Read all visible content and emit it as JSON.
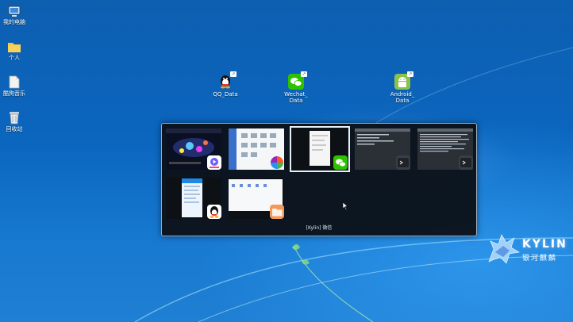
{
  "desktop_icons": [
    {
      "label": "我的电脑",
      "icon": "computer-icon"
    },
    {
      "label": "个人",
      "icon": "folder-icon"
    },
    {
      "label": "酷狗音乐",
      "icon": "file-icon"
    },
    {
      "label": "回收站",
      "icon": "trash-icon"
    }
  ],
  "app_icons": [
    {
      "label": "QQ_Data",
      "icon": "qq-icon",
      "color": "#ffffff"
    },
    {
      "label_lines": [
        "Wechat_",
        "Data"
      ],
      "icon": "wechat-icon",
      "color": "#2dc100"
    },
    {
      "label_lines": [
        "Android_",
        "Data"
      ],
      "icon": "android-icon",
      "color": "#8bc34a"
    }
  ],
  "switcher": {
    "title": "[Kylin] 微信",
    "windows": [
      {
        "name": "video-player-window",
        "badge": "video-app-icon"
      },
      {
        "name": "file-manager-window",
        "badge": "color-palette-icon"
      },
      {
        "name": "wechat-window",
        "badge": "wechat-icon",
        "selected": true
      },
      {
        "name": "terminal-window-1",
        "badge": "terminal-icon"
      },
      {
        "name": "terminal-window-2",
        "badge": "terminal-icon"
      },
      {
        "name": "qq-window",
        "badge": "qq-icon"
      },
      {
        "name": "folder-window",
        "badge": "folder-icon"
      }
    ]
  },
  "logo": {
    "word": "KYLIN",
    "sub": "银河麒麟"
  },
  "colors": {
    "accent_wechat": "#2dc100",
    "desktop_blue": "#0b66bf",
    "switcher_bg": "#0c1016"
  }
}
